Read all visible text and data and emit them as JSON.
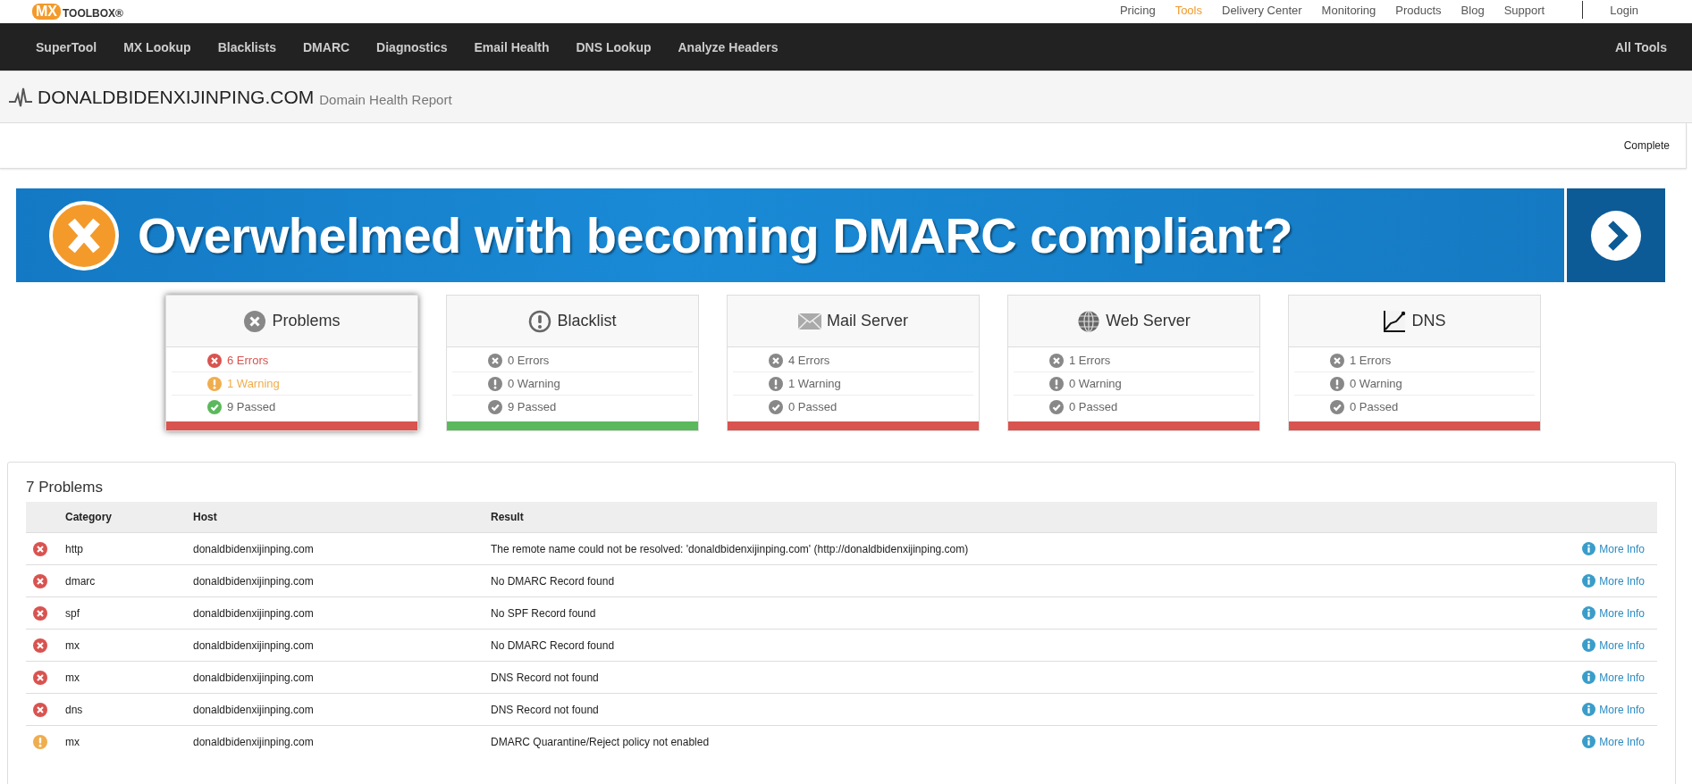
{
  "logo": {
    "mark": "MX",
    "word": "TOOLBOX®"
  },
  "top_links": [
    {
      "label": "Pricing",
      "selected": false
    },
    {
      "label": "Tools",
      "selected": true
    },
    {
      "label": "Delivery Center",
      "selected": false
    },
    {
      "label": "Monitoring",
      "selected": false
    },
    {
      "label": "Products",
      "selected": false
    },
    {
      "label": "Blog",
      "selected": false
    },
    {
      "label": "Support",
      "selected": false
    }
  ],
  "login": "Login",
  "nav": [
    "SuperTool",
    "MX Lookup",
    "Blacklists",
    "DMARC",
    "Diagnostics",
    "Email Health",
    "DNS Lookup",
    "Analyze Headers"
  ],
  "nav_right": "All Tools",
  "report": {
    "domain": "DONALDBIDENXIJINPING.COM",
    "subtitle": "Domain Health Report",
    "status": "Complete"
  },
  "banner": {
    "text": "Overwhelmed with becoming DMARC compliant?"
  },
  "cards": [
    {
      "title": "Problems",
      "selected": true,
      "color": "#d9534f",
      "rows": [
        {
          "kind": "error",
          "text": "6 Errors"
        },
        {
          "kind": "warning",
          "text": "1 Warning"
        },
        {
          "kind": "passed",
          "text": "9 Passed"
        }
      ]
    },
    {
      "title": "Blacklist",
      "selected": false,
      "color": "#5cb85c",
      "rows": [
        {
          "kind": "error",
          "text": "0 Errors"
        },
        {
          "kind": "warning",
          "text": "0 Warning"
        },
        {
          "kind": "passed",
          "text": "9 Passed"
        }
      ]
    },
    {
      "title": "Mail Server",
      "selected": false,
      "color": "#d9534f",
      "rows": [
        {
          "kind": "error",
          "text": "4 Errors"
        },
        {
          "kind": "warning",
          "text": "1 Warning"
        },
        {
          "kind": "passed",
          "text": "0 Passed"
        }
      ]
    },
    {
      "title": "Web Server",
      "selected": false,
      "color": "#d9534f",
      "rows": [
        {
          "kind": "error",
          "text": "1 Errors"
        },
        {
          "kind": "warning",
          "text": "0 Warning"
        },
        {
          "kind": "passed",
          "text": "0 Passed"
        }
      ]
    },
    {
      "title": "DNS",
      "selected": false,
      "color": "#d9534f",
      "rows": [
        {
          "kind": "error",
          "text": "1 Errors"
        },
        {
          "kind": "warning",
          "text": "0 Warning"
        },
        {
          "kind": "passed",
          "text": "0 Passed"
        }
      ]
    }
  ],
  "problems": {
    "title": "7 Problems",
    "columns": [
      "Category",
      "Host",
      "Result"
    ],
    "rows": [
      {
        "kind": "error",
        "category": "http",
        "host": "donaldbidenxijinping.com",
        "result": "The remote name could not be resolved: 'donaldbidenxijinping.com' (http://donaldbidenxijinping.com)",
        "link": "More Info"
      },
      {
        "kind": "error",
        "category": "dmarc",
        "host": "donaldbidenxijinping.com",
        "result": "No DMARC Record found",
        "link": "More Info"
      },
      {
        "kind": "error",
        "category": "spf",
        "host": "donaldbidenxijinping.com",
        "result": "No SPF Record found",
        "link": "More Info"
      },
      {
        "kind": "error",
        "category": "mx",
        "host": "donaldbidenxijinping.com",
        "result": "No DMARC Record found",
        "link": "More Info"
      },
      {
        "kind": "error",
        "category": "mx",
        "host": "donaldbidenxijinping.com",
        "result": "DNS Record not found",
        "link": "More Info"
      },
      {
        "kind": "error",
        "category": "dns",
        "host": "donaldbidenxijinping.com",
        "result": "DNS Record not found",
        "link": "More Info"
      },
      {
        "kind": "warning",
        "category": "mx",
        "host": "donaldbidenxijinping.com",
        "result": "DMARC Quarantine/Reject policy not enabled",
        "link": "More Info"
      }
    ]
  }
}
